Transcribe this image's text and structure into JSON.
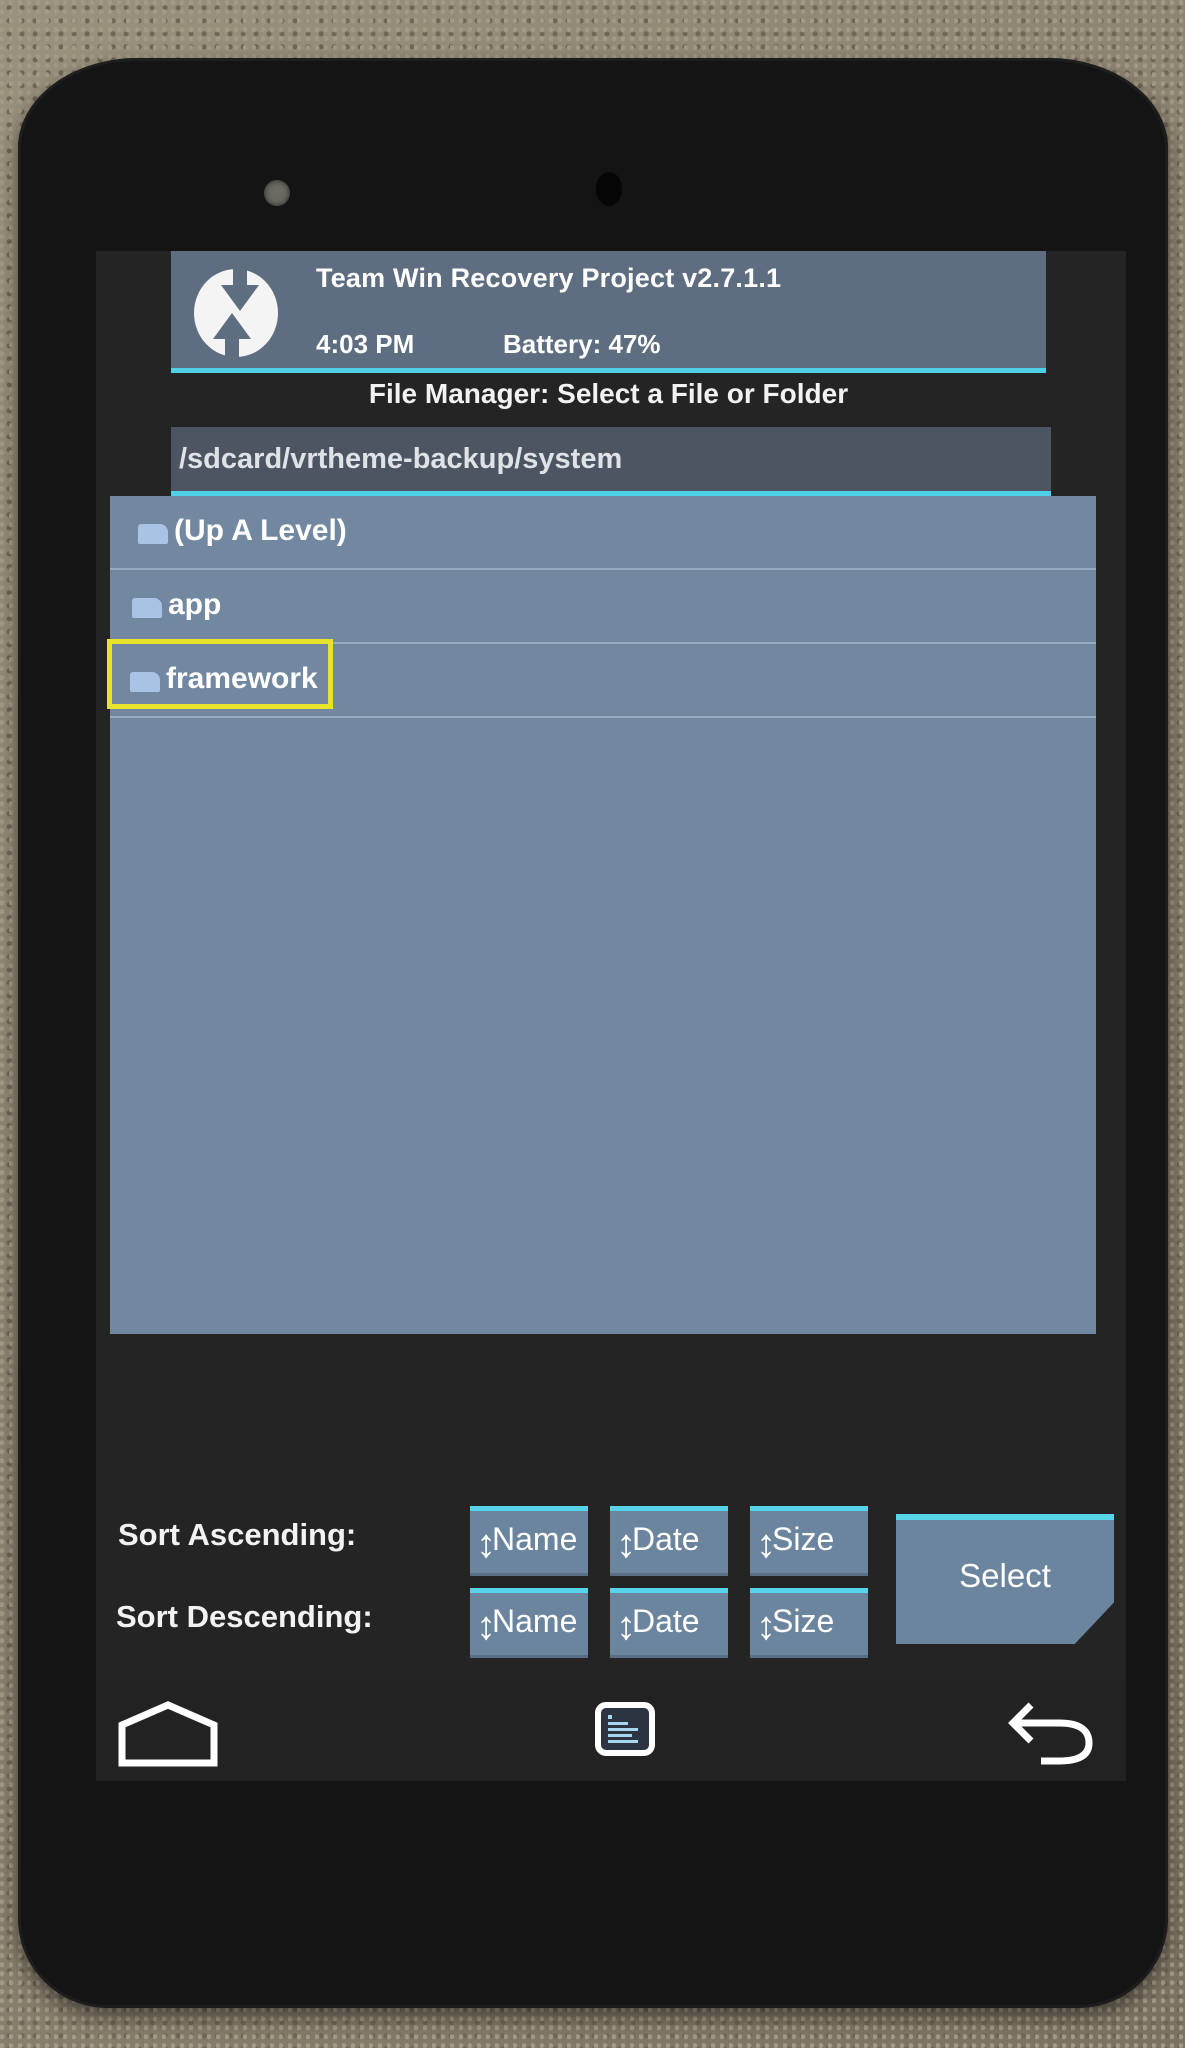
{
  "header": {
    "app_title": "Team Win Recovery Project  v2.7.1.1",
    "time": "4:03 PM",
    "battery": "Battery: 47%"
  },
  "file_manager": {
    "title": "File Manager: Select a File or Folder",
    "current_path": "/sdcard/vrtheme-backup/system",
    "entries": [
      {
        "label": "(Up A Level)",
        "type": "folder"
      },
      {
        "label": "app",
        "type": "folder"
      },
      {
        "label": "framework",
        "type": "folder",
        "highlighted": true
      }
    ]
  },
  "sort": {
    "ascending_label": "Sort Ascending:",
    "descending_label": "Sort Descending:",
    "ascending_buttons": [
      "Name",
      "Date",
      "Size"
    ],
    "descending_buttons": [
      "Name",
      "Date",
      "Size"
    ],
    "arrow_glyph": "↕"
  },
  "actions": {
    "select_label": "Select"
  },
  "nav": {
    "icons": [
      "home-icon",
      "console-icon",
      "back-icon"
    ]
  },
  "colors": {
    "accent": "#4fd0e6",
    "highlight_box": "#e8e22a",
    "list_bg": "#7287a0",
    "header_bg": "#5e6e80"
  }
}
